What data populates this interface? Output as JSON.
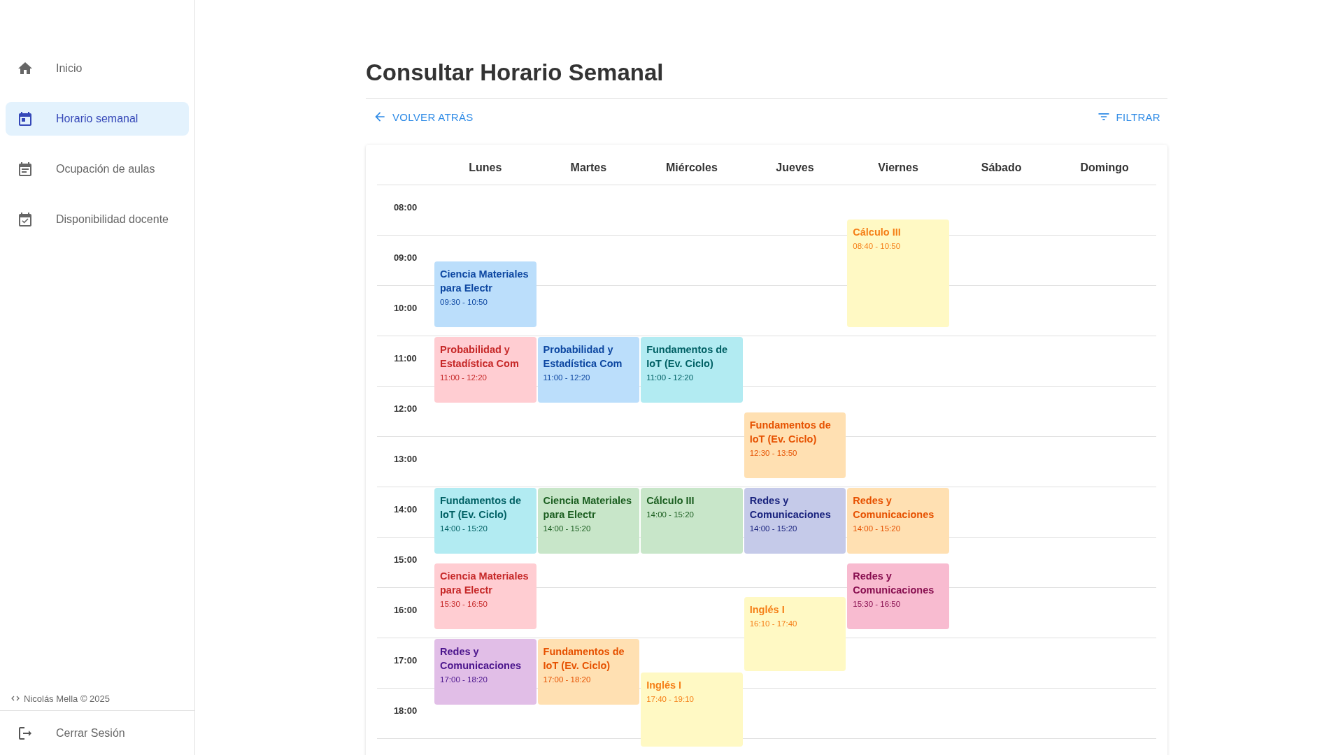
{
  "sidebar": {
    "items": [
      {
        "label": "Inicio",
        "selected": false
      },
      {
        "label": "Horario semanal",
        "selected": true
      },
      {
        "label": "Ocupación de aulas",
        "selected": false
      },
      {
        "label": "Disponibilidad docente",
        "selected": false
      }
    ],
    "footer": "Nicolás Mella © 2025",
    "logout": "Cerrar Sesión"
  },
  "page": {
    "title": "Consultar Horario Semanal",
    "back": "VOLVER ATRÁS",
    "filter": "FILTRAR"
  },
  "calendar": {
    "hours": [
      "08:00",
      "09:00",
      "10:00",
      "11:00",
      "12:00",
      "13:00",
      "14:00",
      "15:00",
      "16:00",
      "17:00",
      "18:00"
    ],
    "days": [
      {
        "label": "Lunes",
        "events": [
          {
            "title": "Ciencia Materiales para Electr",
            "time": "09:30 - 10:50",
            "color": "#bbdefb"
          },
          {
            "title": "Probabilidad y Estadística Com",
            "time": "11:00 - 12:20",
            "color": "#ffcdd2"
          },
          {
            "title": "Fundamentos de IoT (Ev. Ciclo)",
            "time": "14:00 - 15:20",
            "color": "#b2ebf2"
          },
          {
            "title": "Ciencia Materiales para Electr",
            "time": "15:30 - 16:50",
            "color": "#ffcdd2"
          },
          {
            "title": "Redes y Comunicaciones",
            "time": "17:00 - 18:20",
            "color": "#e1bee7"
          }
        ]
      },
      {
        "label": "Martes",
        "events": [
          {
            "title": "Probabilidad y Estadística Com",
            "time": "11:00 - 12:20",
            "color": "#bbdefb"
          },
          {
            "title": "Ciencia Materiales para Electr",
            "time": "14:00 - 15:20",
            "color": "#c8e6c9"
          },
          {
            "title": "Fundamentos de IoT (Ev. Ciclo)",
            "time": "17:00 - 18:20",
            "color": "#ffe0b2"
          }
        ]
      },
      {
        "label": "Miércoles",
        "events": [
          {
            "title": "Fundamentos de IoT (Ev. Ciclo)",
            "time": "11:00 - 12:20",
            "color": "#b2ebf2"
          },
          {
            "title": "Cálculo III",
            "time": "14:00 - 15:20",
            "color": "#c8e6c9"
          },
          {
            "title": "Inglés I",
            "time": "17:40 - 19:10",
            "color": "#fff9c4"
          }
        ]
      },
      {
        "label": "Jueves",
        "events": [
          {
            "title": "Fundamentos de IoT (Ev. Ciclo)",
            "time": "12:30 - 13:50",
            "color": "#ffe0b2"
          },
          {
            "title": "Redes y Comunicaciones",
            "time": "14:00 - 15:20",
            "color": "#c5cae9"
          },
          {
            "title": "Inglés I",
            "time": "16:10 - 17:40",
            "color": "#fff9c4"
          }
        ]
      },
      {
        "label": "Viernes",
        "events": [
          {
            "title": "Cálculo III",
            "time": "08:40 - 10:50",
            "color": "#fff9c4"
          },
          {
            "title": "Redes y Comunicaciones",
            "time": "14:00 - 15:20",
            "color": "#ffe0b2"
          },
          {
            "title": "Redes y Comunicaciones",
            "time": "15:30 - 16:50",
            "color": "#f8bbd0"
          }
        ]
      },
      {
        "label": "Sábado"
      },
      {
        "label": "Domingo"
      }
    ]
  }
}
